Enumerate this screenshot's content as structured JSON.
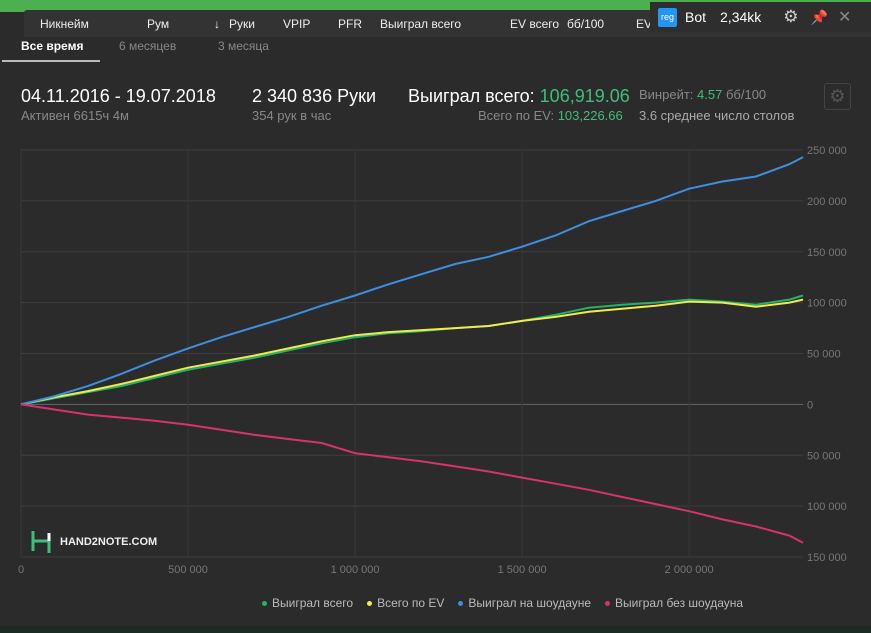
{
  "columns": [
    "Никнейм",
    "Рум",
    "Руки",
    "VPIP",
    "PFR",
    "Выиграл всего",
    "EV всего",
    "бб/100",
    "EV"
  ],
  "popup": {
    "badge": "reg",
    "name": "Bot",
    "value": "2,34kk"
  },
  "tabs": [
    "Все время",
    "6 месяцев",
    "3 месяца"
  ],
  "stats": {
    "period": "04.11.2016 - 19.07.2018",
    "active": "Активен 6615ч 4м",
    "hands": "2 340 836 Руки",
    "hands_per_hour": "354 рук в час",
    "won_label": "Выиграл всего:",
    "won_value": "106,919.06",
    "ev_label": "Всего по EV:",
    "ev_value": "103,226.66",
    "winrate_label": "Винрейт:",
    "winrate_value": "4.57",
    "winrate_unit": "бб/100",
    "tables": "3.6 среднее число столов"
  },
  "logo": "HAND2NOTE.COM",
  "chart_data": {
    "type": "line",
    "x": [
      0,
      100000,
      200000,
      300000,
      400000,
      500000,
      600000,
      700000,
      800000,
      900000,
      1000000,
      1100000,
      1200000,
      1300000,
      1400000,
      1500000,
      1600000,
      1700000,
      1800000,
      1900000,
      2000000,
      2100000,
      2200000,
      2300000,
      2340836
    ],
    "xlim": [
      0,
      2340836
    ],
    "ylim": [
      -150000,
      250000
    ],
    "xticks": [
      0,
      500000,
      1000000,
      1500000,
      2000000
    ],
    "xtick_labels": [
      "0",
      "500 000",
      "1 000 000",
      "1 500 000",
      "2 000 000"
    ],
    "yticks": [
      250000,
      200000,
      150000,
      100000,
      50000,
      0,
      -50000,
      -100000,
      -150000
    ],
    "ytick_labels": [
      "250 000",
      "200 000",
      "150 000",
      "100 000",
      "50 000",
      "0",
      "50 000",
      "100 000",
      "150 000"
    ],
    "grid": true,
    "legend": "bottom-right",
    "series": [
      {
        "name": "Выиграл всего",
        "color": "#21b36b",
        "values": [
          0,
          6000,
          12000,
          18000,
          26000,
          34000,
          40000,
          46000,
          53000,
          60000,
          66000,
          70000,
          72000,
          75000,
          77000,
          82000,
          88000,
          95000,
          98000,
          100000,
          103000,
          101000,
          98000,
          103000,
          107000
        ]
      },
      {
        "name": "Всего по EV",
        "color": "#f2e94b",
        "values": [
          0,
          7000,
          13000,
          20000,
          28000,
          36000,
          42000,
          48000,
          55000,
          62000,
          68000,
          71000,
          73000,
          75000,
          77000,
          82000,
          86000,
          91000,
          94000,
          97000,
          101000,
          100000,
          96000,
          100000,
          103000
        ]
      },
      {
        "name": "Выиграл на шоудауне",
        "color": "#3d8fe0",
        "values": [
          0,
          8000,
          18000,
          30000,
          43000,
          55000,
          66000,
          76000,
          86000,
          97000,
          107000,
          118000,
          128000,
          138000,
          145000,
          155000,
          166000,
          180000,
          190000,
          200000,
          212000,
          219000,
          224000,
          236000,
          243000
        ]
      },
      {
        "name": "Выиграл без шоудауна",
        "color": "#d6336c",
        "values": [
          0,
          -5000,
          -10000,
          -13000,
          -16000,
          -20000,
          -25000,
          -30000,
          -34000,
          -38000,
          -48000,
          -52000,
          -56000,
          -61000,
          -66000,
          -72000,
          -78000,
          -84000,
          -91000,
          -98000,
          -105000,
          -113000,
          -120000,
          -129000,
          -136000
        ]
      }
    ]
  }
}
